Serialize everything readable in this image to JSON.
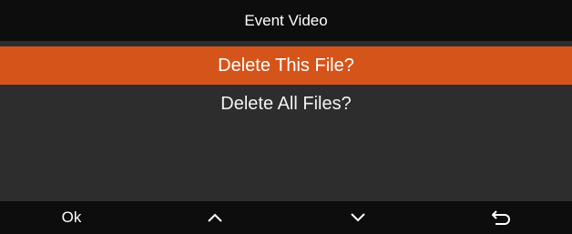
{
  "header": {
    "title": "Event Video"
  },
  "menu": {
    "items": [
      {
        "label": "Delete This File?",
        "selected": true
      },
      {
        "label": "Delete All Files?",
        "selected": false
      }
    ]
  },
  "footer": {
    "ok_label": "Ok",
    "up_icon": "chevron-up-icon",
    "down_icon": "chevron-down-icon",
    "back_icon": "back-arrow-icon"
  },
  "colors": {
    "accent": "#d5541a",
    "background": "#2d2d2d",
    "bars": "#0d0d0d"
  }
}
